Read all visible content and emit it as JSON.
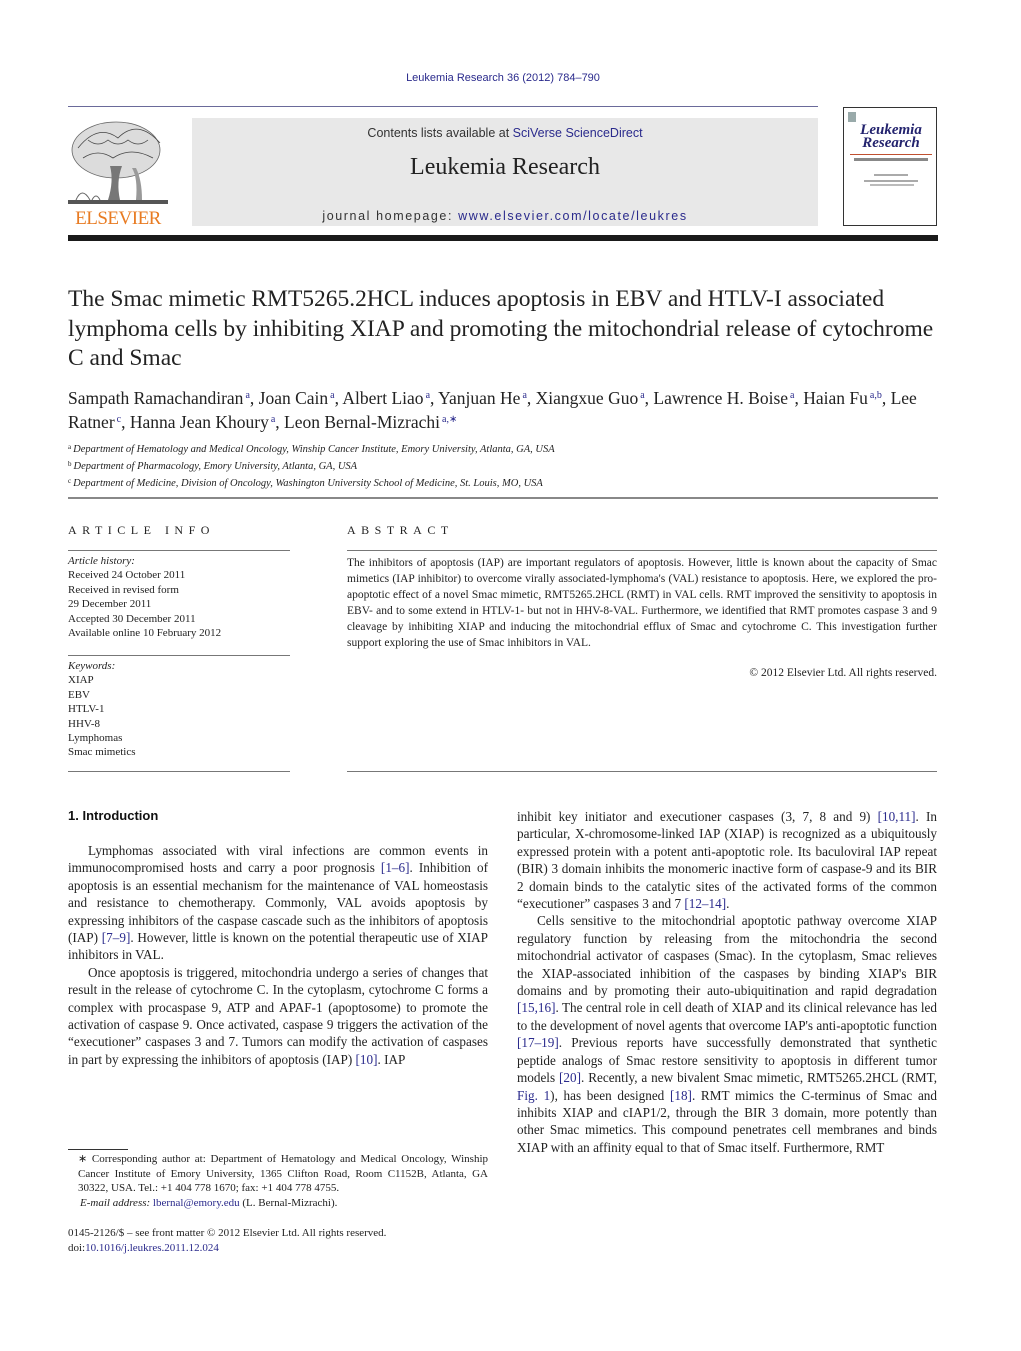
{
  "running_head": "Leukemia Research 36 (2012) 784–790",
  "header": {
    "publisher_wordmark": "ELSEVIER",
    "contents_prefix": "Contents lists available at ",
    "contents_link": "SciVerse ScienceDirect",
    "journal_name": "Leukemia Research",
    "homepage_prefix": "journal homepage: ",
    "homepage_link": "www.elsevier.com/locate/leukres",
    "cover_title_line1": "Leukemia",
    "cover_title_line2": "Research",
    "accent_color": "#2a2a8c",
    "wordmark_color": "#e87b22"
  },
  "article": {
    "title": "The Smac mimetic RMT5265.2HCL induces apoptosis in EBV and HTLV-I associated lymphoma cells by inhibiting XIAP and promoting the mitochondrial release of cytochrome C and Smac",
    "authors": [
      {
        "name": "Sampath Ramachandiran",
        "aff": "a"
      },
      {
        "name": "Joan Cain",
        "aff": "a"
      },
      {
        "name": "Albert Liao",
        "aff": "a"
      },
      {
        "name": "Yanjuan He",
        "aff": "a"
      },
      {
        "name": "Xiangxue Guo",
        "aff": "a"
      },
      {
        "name": "Lawrence H. Boise",
        "aff": "a"
      },
      {
        "name": "Haian Fu",
        "aff": "a,b"
      },
      {
        "name": "Lee Ratner",
        "aff": "c"
      },
      {
        "name": "Hanna Jean Khoury",
        "aff": "a"
      },
      {
        "name": "Leon Bernal-Mizrachi",
        "aff": "a,∗"
      }
    ],
    "affiliations": [
      {
        "mark": "a",
        "text": "Department of Hematology and Medical Oncology, Winship Cancer Institute, Emory University, Atlanta, GA, USA"
      },
      {
        "mark": "b",
        "text": "Department of Pharmacology, Emory University, Atlanta, GA, USA"
      },
      {
        "mark": "c",
        "text": "Department of Medicine, Division of Oncology, Washington University School of Medicine, St. Louis, MO, USA"
      }
    ]
  },
  "article_info": {
    "heading": "ARTICLE INFO",
    "history_label": "Article history:",
    "history": [
      "Received 24 October 2011",
      "Received in revised form",
      "29 December 2011",
      "Accepted 30 December 2011",
      "Available online 10 February 2012"
    ],
    "keywords_label": "Keywords:",
    "keywords": [
      "XIAP",
      "EBV",
      "HTLV-1",
      "HHV-8",
      "Lymphomas",
      "Smac mimetics"
    ]
  },
  "abstract": {
    "heading": "ABSTRACT",
    "text": "The inhibitors of apoptosis (IAP) are important regulators of apoptosis. However, little is known about the capacity of Smac mimetics (IAP inhibitor) to overcome virally associated-lymphoma's (VAL) resistance to apoptosis. Here, we explored the pro-apoptotic effect of a novel Smac mimetic, RMT5265.2HCL (RMT) in VAL cells. RMT improved the sensitivity to apoptosis in EBV- and to some extend in HTLV-1- but not in HHV-8-VAL. Furthermore, we identified that RMT promotes caspase 3 and 9 cleavage by inhibiting XIAP and inducing the mitochondrial efflux of Smac and cytochrome C. This investigation further support exploring the use of Smac inhibitors in VAL.",
    "copyright": "© 2012 Elsevier Ltd. All rights reserved."
  },
  "body": {
    "section_heading": "1.  Introduction",
    "left_paragraphs": [
      [
        {
          "t": "Lymphomas associated with viral infections are common events in immunocompromised hosts and carry a poor prognosis "
        },
        {
          "ref": "[1–6]"
        },
        {
          "t": ". Inhibition of apoptosis is an essential mechanism for the maintenance of VAL homeostasis and resistance to chemotherapy. Commonly, VAL avoids apoptosis by expressing inhibitors of the caspase cascade such as the inhibitors of apoptosis (IAP) "
        },
        {
          "ref": "[7–9]"
        },
        {
          "t": ". However, little is known on the potential therapeutic use of XIAP inhibitors in VAL."
        }
      ],
      [
        {
          "t": "Once apoptosis is triggered, mitochondria undergo a series of changes that result in the release of cytochrome C. In the cytoplasm, cytochrome C forms a complex with procaspase 9, ATP and APAF-1 (apoptosome) to promote the activation of caspase 9. Once activated, caspase 9 triggers the activation of the “executioner” caspases 3 and 7. Tumors can modify the activation of caspases in part by expressing the inhibitors of apoptosis (IAP) "
        },
        {
          "ref": "[10]"
        },
        {
          "t": ". IAP"
        }
      ]
    ],
    "right_paragraphs": [
      [
        {
          "t": "inhibit key initiator and executioner caspases (3, 7, 8 and 9) "
        },
        {
          "ref": "[10,11]"
        },
        {
          "t": ". In particular, X-chromosome-linked IAP (XIAP) is recognized as a ubiquitously expressed protein with a potent anti-apoptotic role. Its baculoviral IAP repeat (BIR) 3 domain inhibits the monomeric inactive form of caspase-9 and its BIR 2 domain binds to the catalytic sites of the activated forms of the common “executioner” caspases 3 and 7 "
        },
        {
          "ref": "[12–14]"
        },
        {
          "t": "."
        }
      ],
      [
        {
          "t": "Cells sensitive to the mitochondrial apoptotic pathway overcome XIAP regulatory function by releasing from the mitochondria the second mitochondrial activator of caspases (Smac). In the cytoplasm, Smac relieves the XIAP-associated inhibition of the caspases by binding XIAP's BIR domains and by promoting their auto-ubiquitination and rapid degradation "
        },
        {
          "ref": "[15,16]"
        },
        {
          "t": ". The central role in cell death of XIAP and its clinical relevance has led to the development of novel agents that overcome IAP's anti-apoptotic function "
        },
        {
          "ref": "[17–19]"
        },
        {
          "t": ". Previous reports have successfully demonstrated that synthetic peptide analogs of Smac restore sensitivity to apoptosis in different tumor models "
        },
        {
          "ref": "[20]"
        },
        {
          "t": ". Recently, a new bivalent Smac mimetic, RMT5265.2HCL (RMT, "
        },
        {
          "ref": "Fig. 1"
        },
        {
          "t": "), has been designed "
        },
        {
          "ref": "[18]"
        },
        {
          "t": ". RMT mimics the C-terminus of Smac and inhibits XIAP and cIAP1/2, through the BIR 3 domain, more potently than other Smac mimetics. This compound penetrates cell membranes and binds XIAP with an affinity equal to that of Smac itself. Furthermore, RMT"
        }
      ]
    ]
  },
  "footnote": {
    "corresponding": "∗  Corresponding author at: Department of Hematology and Medical Oncology, Winship Cancer Institute of Emory University, 1365 Clifton Road, Room C1152B, Atlanta, GA 30322, USA. Tel.: +1 404 778 1670; fax: +1 404 778 4755.",
    "email_label": "E-mail address: ",
    "email": "lbernal@emory.edu",
    "email_suffix": " (L. Bernal-Mizrachi).",
    "front_matter": "0145-2126/$ – see front matter © 2012 Elsevier Ltd. All rights reserved.",
    "doi_label": "doi:",
    "doi": "10.1016/j.leukres.2011.12.024"
  }
}
